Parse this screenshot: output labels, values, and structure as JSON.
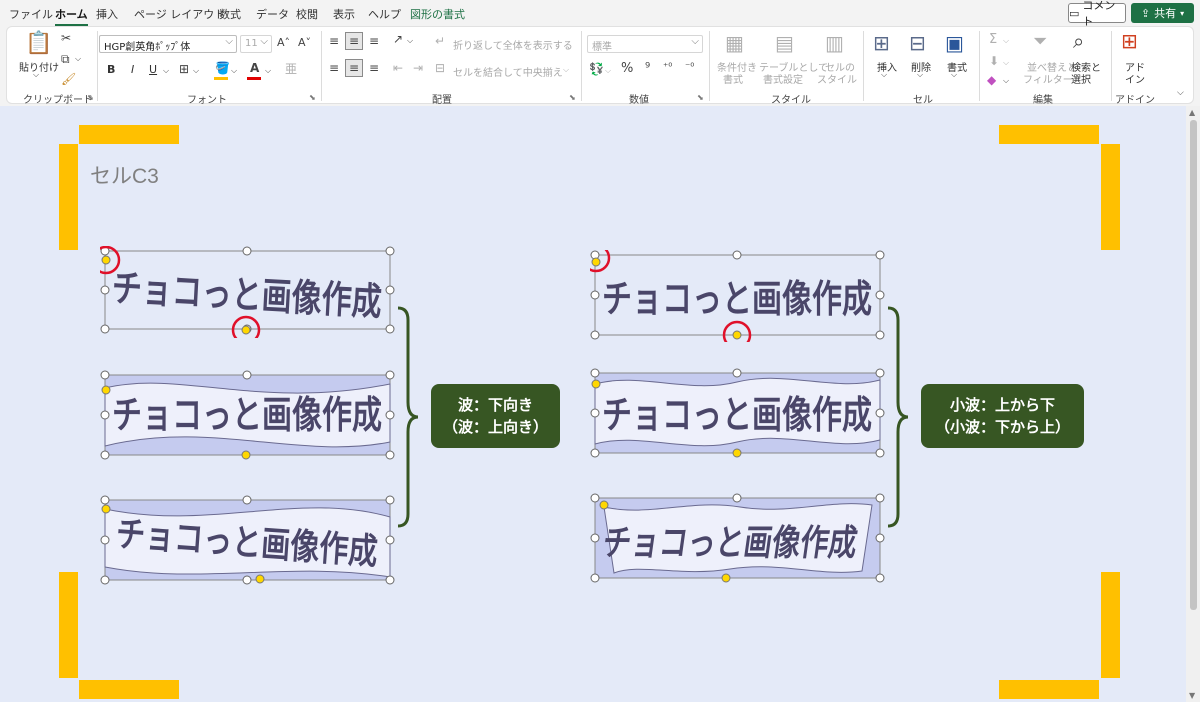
{
  "tabs": [
    "ファイル",
    "ホーム",
    "挿入",
    "ページ レイアウト",
    "数式",
    "データ",
    "校閲",
    "表示",
    "ヘルプ",
    "図形の書式"
  ],
  "active_tab": "ホーム",
  "comment_button": "コメント",
  "share_button": "共有",
  "clipboard": {
    "paste": "貼り付け",
    "group": "クリップボード"
  },
  "font": {
    "name": "HGP創英角ﾎﾟｯﾌﾟ体",
    "size": "11",
    "bold": "B",
    "italic": "I",
    "underline": "U",
    "group": "フォント"
  },
  "alignment": {
    "wrap": "折り返して全体を表示する",
    "merge": "セルを結合して中央揃え",
    "group": "配置"
  },
  "number": {
    "format": "標準",
    "group": "数値"
  },
  "styles": {
    "conditional": [
      "条件付き",
      "書式"
    ],
    "table": [
      "テーブルとして",
      "書式設定"
    ],
    "cell_style": [
      "セルの",
      "スタイル"
    ],
    "group": "スタイル"
  },
  "cells": {
    "insert": "挿入",
    "delete": "削除",
    "format": "書式",
    "group": "セル"
  },
  "editing": {
    "sort": [
      "並べ替えと",
      "フィルター"
    ],
    "find": [
      "検索と",
      "選択"
    ],
    "group": "編集"
  },
  "addins": {
    "label": [
      "アド",
      "イン"
    ],
    "group": "アドイン"
  },
  "sheet": {
    "cell_label": "セルC3",
    "wordart_text": "チョコっと画像作成",
    "callout_left": [
      "波：下向き",
      "（波：上向き）"
    ],
    "callout_right": [
      "小波：上から下",
      "（小波：下から上）"
    ],
    "colors": {
      "background": "#e4eaf8",
      "corner": "#ffc000",
      "callout": "#375623",
      "text": "#4a4669",
      "wave_fill": "#c5cbef"
    }
  }
}
